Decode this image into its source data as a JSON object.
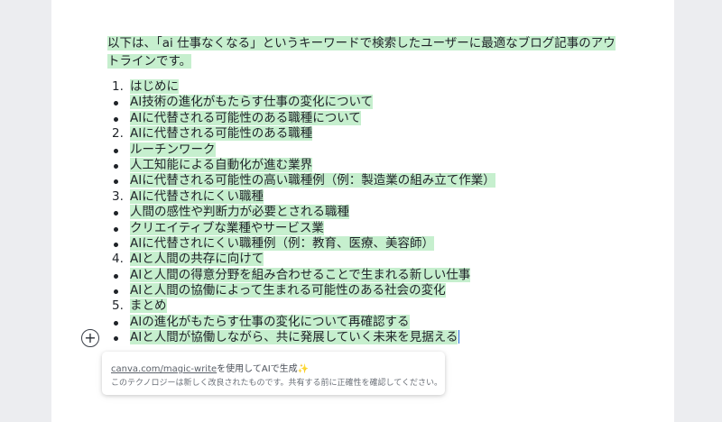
{
  "document": {
    "intro": "以下は、「ai 仕事なくなる」というキーワードで検索したユーザーに最適なブログ記事のアウトラインです。",
    "items": [
      {
        "type": "num",
        "marker": "1.",
        "text": "はじめに"
      },
      {
        "type": "bullet",
        "marker": "",
        "text": "AI技術の進化がもたらす仕事の変化について"
      },
      {
        "type": "bullet",
        "marker": "",
        "text": "AIに代替される可能性のある職種について"
      },
      {
        "type": "num",
        "marker": "2.",
        "text": "AIに代替される可能性のある職種"
      },
      {
        "type": "bullet",
        "marker": "",
        "text": "ルーチンワーク"
      },
      {
        "type": "bullet",
        "marker": "",
        "text": "人工知能による自動化が進む業界"
      },
      {
        "type": "bullet",
        "marker": "",
        "text": "AIに代替される可能性の高い職種例（例：製造業の組み立て作業）"
      },
      {
        "type": "num",
        "marker": "3.",
        "text": "AIに代替されにくい職種"
      },
      {
        "type": "bullet",
        "marker": "",
        "text": "人間の感性や判断力が必要とされる職種"
      },
      {
        "type": "bullet",
        "marker": "",
        "text": "クリエイティブな業種やサービス業"
      },
      {
        "type": "bullet",
        "marker": "",
        "text": "AIに代替されにくい職種例（例：教育、医療、美容師）"
      },
      {
        "type": "num",
        "marker": "4.",
        "text": "AIと人間の共存に向けて"
      },
      {
        "type": "bullet",
        "marker": "",
        "text": "AIと人間の得意分野を組み合わせることで生まれる新しい仕事"
      },
      {
        "type": "bullet",
        "marker": "",
        "text": "AIと人間の協働によって生まれる可能性のある社会の変化"
      },
      {
        "type": "num",
        "marker": "5.",
        "text": "まとめ"
      },
      {
        "type": "bullet",
        "marker": "",
        "text": "AIの進化がもたらす仕事の変化について再確認する"
      },
      {
        "type": "bullet",
        "marker": "",
        "text": "AIと人間が協働しながら、共に発展していく未来を見据える"
      }
    ]
  },
  "add_button": {
    "icon": "plus-icon",
    "symbol": "+"
  },
  "popup": {
    "link_text": "canva.com/magic-write",
    "suffix": "を使用してAIで生成",
    "sparkle": "✨",
    "note": "このテクノロジーは新しく改良されたものです。共有する前に正確性を確認してください。"
  },
  "colors": {
    "highlight": "#c6efce",
    "page_bg": "#ecedf0",
    "caret": "#1b6ad2"
  }
}
